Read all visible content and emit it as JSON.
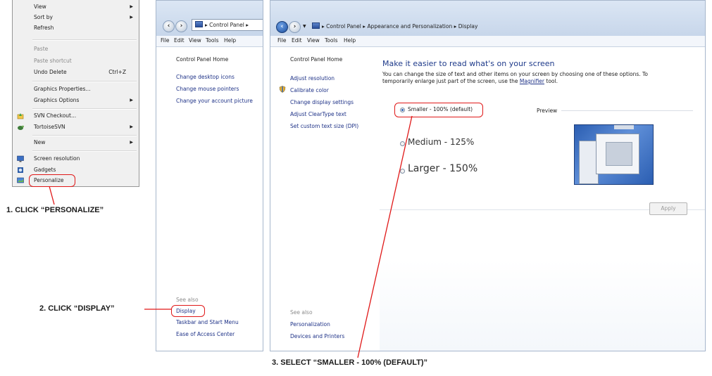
{
  "context_menu": {
    "items": [
      {
        "label": "View",
        "submenu": true,
        "disabled": false
      },
      {
        "label": "Sort by",
        "submenu": true,
        "disabled": false
      },
      {
        "label": "Refresh",
        "submenu": false,
        "disabled": false
      },
      {
        "label": "Paste",
        "submenu": false,
        "disabled": true
      },
      {
        "label": "Paste shortcut",
        "submenu": false,
        "disabled": true
      },
      {
        "label": "Undo Delete",
        "shortcut": "Ctrl+Z",
        "submenu": false,
        "disabled": false
      },
      {
        "label": "Graphics Properties...",
        "submenu": false,
        "disabled": false
      },
      {
        "label": "Graphics Options",
        "submenu": true,
        "disabled": false
      },
      {
        "label": "SVN Checkout...",
        "submenu": false,
        "disabled": false,
        "icon": "svn-checkout-icon"
      },
      {
        "label": "TortoiseSVN",
        "submenu": true,
        "disabled": false,
        "icon": "tortoisesvn-icon"
      },
      {
        "label": "New",
        "submenu": true,
        "disabled": false
      },
      {
        "label": "Screen resolution",
        "submenu": false,
        "disabled": false,
        "icon": "screen-resolution-icon"
      },
      {
        "label": "Gadgets",
        "submenu": false,
        "disabled": false,
        "icon": "gadgets-icon"
      },
      {
        "label": "Personalize",
        "submenu": false,
        "disabled": false,
        "icon": "personalize-icon"
      }
    ]
  },
  "personalization_window": {
    "address_path": "Control Panel",
    "menu": [
      "File",
      "Edit",
      "View",
      "Tools",
      "Help"
    ],
    "nav_links": [
      "Control Panel Home",
      "Change desktop icons",
      "Change mouse pointers",
      "Change your account picture"
    ],
    "see_also_label": "See also",
    "see_also_links": [
      "Display",
      "Taskbar and Start Menu",
      "Ease of Access Center"
    ]
  },
  "display_window": {
    "address_path": [
      "Control Panel",
      "Appearance and Personalization",
      "Display"
    ],
    "menu": [
      "File",
      "Edit",
      "View",
      "Tools",
      "Help"
    ],
    "nav_links": [
      "Control Panel Home",
      "Adjust resolution",
      "Calibrate color",
      "Change display settings",
      "Adjust ClearType text",
      "Set custom text size (DPI)"
    ],
    "see_also_label": "See also",
    "see_also_links": [
      "Personalization",
      "Devices and Printers"
    ],
    "heading": "Make it easier to read what's on your screen",
    "description_1": "You can change the size of text and other items on your screen by choosing one of these options. To",
    "description_2_pre": "temporarily enlarge just part of the screen, use the ",
    "magnifier_link": "Magnifier",
    "description_2_post": " tool.",
    "options": [
      {
        "label": "Smaller - 100% (default)",
        "selected": true
      },
      {
        "label": "Medium - 125%",
        "selected": false
      },
      {
        "label": "Larger - 150%",
        "selected": false
      }
    ],
    "preview_label": "Preview",
    "apply_label": "Apply"
  },
  "annotations": {
    "step1": "1. CLICK “PERSONALIZE”",
    "step2": "2. CLICK “DISPLAY”",
    "step3": "3. SELECT “SMALLER - 100% (DEFAULT)”"
  },
  "colors": {
    "annotation_red": "#e01818",
    "link_blue": "#1e3287",
    "window_border": "#a7b7cc"
  }
}
